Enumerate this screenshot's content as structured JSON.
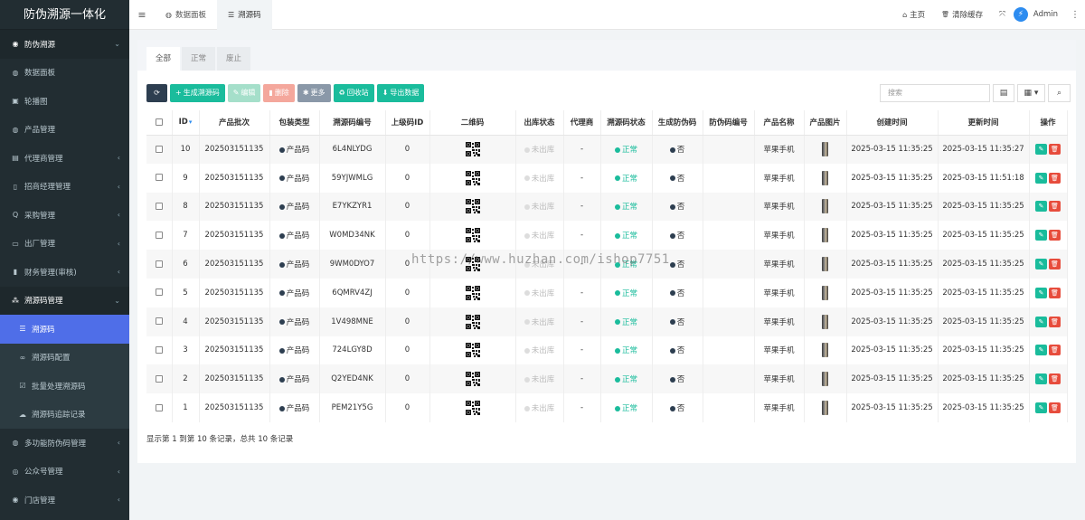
{
  "sidebar": {
    "brand": "防伪溯源一体化",
    "items": [
      {
        "label": "防伪溯源",
        "icon": "dashboard-icon",
        "glyph": "◉",
        "arrow": "⌄",
        "state": "parent-open"
      },
      {
        "label": "数据面板",
        "icon": "gauge-icon",
        "glyph": "◍",
        "arrow": "",
        "state": ""
      },
      {
        "label": "轮播图",
        "icon": "image-icon",
        "glyph": "▣",
        "arrow": "",
        "state": ""
      },
      {
        "label": "产品管理",
        "icon": "gauge-icon",
        "glyph": "◍",
        "arrow": "",
        "state": ""
      },
      {
        "label": "代理商管理",
        "icon": "id-card-icon",
        "glyph": "▤",
        "arrow": "‹",
        "state": ""
      },
      {
        "label": "招商经理管理",
        "icon": "file-icon",
        "glyph": "▯",
        "arrow": "‹",
        "state": ""
      },
      {
        "label": "采购管理",
        "icon": "search-icon",
        "glyph": "Q",
        "arrow": "‹",
        "state": ""
      },
      {
        "label": "出厂管理",
        "icon": "truck-icon",
        "glyph": "▭",
        "arrow": "‹",
        "state": ""
      },
      {
        "label": "财务管理(审核)",
        "icon": "book-icon",
        "glyph": "▮",
        "arrow": "‹",
        "state": ""
      },
      {
        "label": "溯源码管理",
        "icon": "cubes-icon",
        "glyph": "⁂",
        "arrow": "⌄",
        "state": "parent-open"
      },
      {
        "label": "溯源码",
        "icon": "list-icon",
        "glyph": "☰",
        "arrow": "",
        "state": "sub active"
      },
      {
        "label": "溯源码配置",
        "icon": "link-icon",
        "glyph": "∞",
        "arrow": "",
        "state": "sub"
      },
      {
        "label": "批量处理溯源码",
        "icon": "check-icon",
        "glyph": "☑",
        "arrow": "",
        "state": "sub"
      },
      {
        "label": "溯源码追踪记录",
        "icon": "cloud-icon",
        "glyph": "☁",
        "arrow": "",
        "state": "sub"
      },
      {
        "label": "多功能防伪码管理",
        "icon": "gauge-icon",
        "glyph": "◍",
        "arrow": "‹",
        "state": ""
      },
      {
        "label": "公众号管理",
        "icon": "wechat-icon",
        "glyph": "◎",
        "arrow": "‹",
        "state": ""
      },
      {
        "label": "门店管理",
        "icon": "store-icon",
        "glyph": "◉",
        "arrow": "‹",
        "state": ""
      }
    ]
  },
  "topbar": {
    "menu_glyph": "≡",
    "tabs": [
      {
        "label": "数据面板",
        "glyph": "◍",
        "icon": "dashboard-icon",
        "active": false
      },
      {
        "label": "溯源码",
        "glyph": "☰",
        "icon": "list-icon",
        "active": true
      }
    ],
    "home": "主页",
    "home_glyph": "⌂",
    "clear_cache": "清除缓存",
    "trash_glyph": "🗑",
    "fullscreen_glyph": "⤧",
    "avatar_glyph": "⚡",
    "admin": "Admin",
    "more_glyph": "⋮"
  },
  "subtabs": [
    "全部",
    "正常",
    "废止"
  ],
  "toolbar": {
    "refresh_glyph": "⟳",
    "generate": "生成溯源码",
    "edit": "编辑",
    "delete": "删除",
    "more": "更多",
    "recycle": "回收站",
    "export": "导出数据",
    "search_placeholder": "搜索",
    "columns_glyph": "▤",
    "grid_glyph": "▦ ▾",
    "search_glyph": "⌕"
  },
  "table": {
    "headers": [
      "",
      "ID",
      "产品批次",
      "包装类型",
      "溯源码编号",
      "上级码ID",
      "二维码",
      "出库状态",
      "代理商",
      "溯源码状态",
      "生成防伪码",
      "防伪码编号",
      "产品名称",
      "产品图片",
      "创建时间",
      "更新时间",
      "操作"
    ],
    "sort_glyph": "▾",
    "rows": [
      {
        "id": "10",
        "batch": "202503151135",
        "pack": "产品码",
        "code": "6L4NLYDG",
        "parent": "0",
        "out": "未出库",
        "agent": "-",
        "status": "正常",
        "gen": "否",
        "fcode": "",
        "pname": "苹果手机",
        "created": "2025-03-15 11:35:25",
        "updated": "2025-03-15 11:35:27"
      },
      {
        "id": "9",
        "batch": "202503151135",
        "pack": "产品码",
        "code": "59YJWMLG",
        "parent": "0",
        "out": "未出库",
        "agent": "-",
        "status": "正常",
        "gen": "否",
        "fcode": "",
        "pname": "苹果手机",
        "created": "2025-03-15 11:35:25",
        "updated": "2025-03-15 11:51:18"
      },
      {
        "id": "8",
        "batch": "202503151135",
        "pack": "产品码",
        "code": "E7YKZYR1",
        "parent": "0",
        "out": "未出库",
        "agent": "-",
        "status": "正常",
        "gen": "否",
        "fcode": "",
        "pname": "苹果手机",
        "created": "2025-03-15 11:35:25",
        "updated": "2025-03-15 11:35:25"
      },
      {
        "id": "7",
        "batch": "202503151135",
        "pack": "产品码",
        "code": "W0MD34NK",
        "parent": "0",
        "out": "未出库",
        "agent": "-",
        "status": "正常",
        "gen": "否",
        "fcode": "",
        "pname": "苹果手机",
        "created": "2025-03-15 11:35:25",
        "updated": "2025-03-15 11:35:25"
      },
      {
        "id": "6",
        "batch": "202503151135",
        "pack": "产品码",
        "code": "9WM0DYO7",
        "parent": "0",
        "out": "未出库",
        "agent": "-",
        "status": "正常",
        "gen": "否",
        "fcode": "",
        "pname": "苹果手机",
        "created": "2025-03-15 11:35:25",
        "updated": "2025-03-15 11:35:25"
      },
      {
        "id": "5",
        "batch": "202503151135",
        "pack": "产品码",
        "code": "6QMRV4ZJ",
        "parent": "0",
        "out": "未出库",
        "agent": "-",
        "status": "正常",
        "gen": "否",
        "fcode": "",
        "pname": "苹果手机",
        "created": "2025-03-15 11:35:25",
        "updated": "2025-03-15 11:35:25"
      },
      {
        "id": "4",
        "batch": "202503151135",
        "pack": "产品码",
        "code": "1V498MNE",
        "parent": "0",
        "out": "未出库",
        "agent": "-",
        "status": "正常",
        "gen": "否",
        "fcode": "",
        "pname": "苹果手机",
        "created": "2025-03-15 11:35:25",
        "updated": "2025-03-15 11:35:25"
      },
      {
        "id": "3",
        "batch": "202503151135",
        "pack": "产品码",
        "code": "724LGY8D",
        "parent": "0",
        "out": "未出库",
        "agent": "-",
        "status": "正常",
        "gen": "否",
        "fcode": "",
        "pname": "苹果手机",
        "created": "2025-03-15 11:35:25",
        "updated": "2025-03-15 11:35:25"
      },
      {
        "id": "2",
        "batch": "202503151135",
        "pack": "产品码",
        "code": "Q2YED4NK",
        "parent": "0",
        "out": "未出库",
        "agent": "-",
        "status": "正常",
        "gen": "否",
        "fcode": "",
        "pname": "苹果手机",
        "created": "2025-03-15 11:35:25",
        "updated": "2025-03-15 11:35:25"
      },
      {
        "id": "1",
        "batch": "202503151135",
        "pack": "产品码",
        "code": "PEM21Y5G",
        "parent": "0",
        "out": "未出库",
        "agent": "-",
        "status": "正常",
        "gen": "否",
        "fcode": "",
        "pname": "苹果手机",
        "created": "2025-03-15 11:35:25",
        "updated": "2025-03-15 11:35:25"
      }
    ],
    "edit_glyph": "✎",
    "delete_glyph": "🗑"
  },
  "footer": "显示第 1 到第 10 条记录，总共 10 条记录",
  "watermark": "https://www.huzhan.com/ishop7751",
  "colors": {
    "sidebar": "#222d32",
    "active": "#4f6ee8",
    "teal": "#1abc9c",
    "navy": "#2d3e50",
    "red": "#e74c3c"
  }
}
